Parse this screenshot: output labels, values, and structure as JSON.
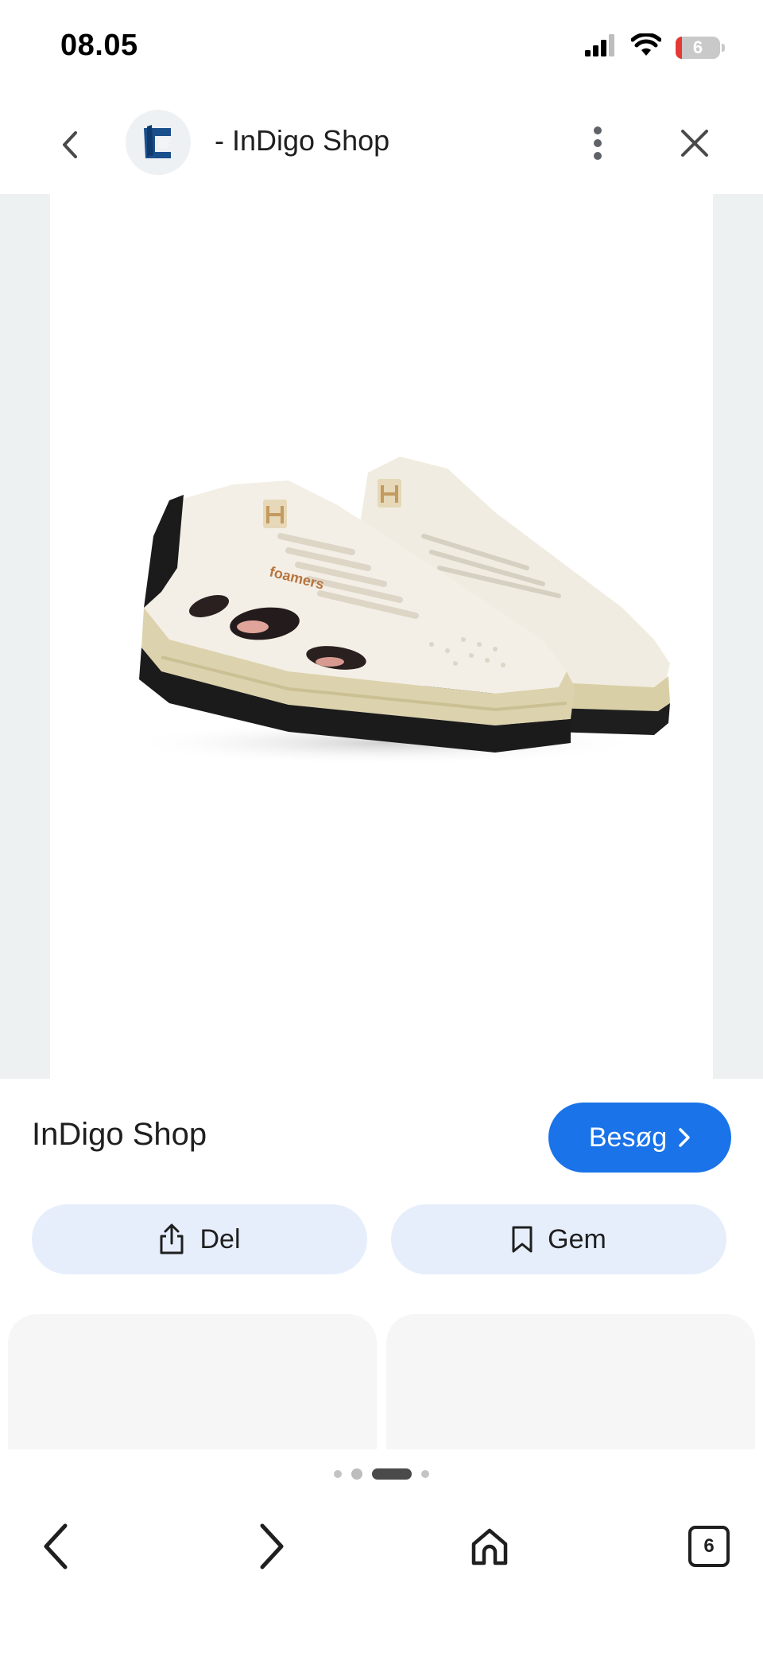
{
  "status_bar": {
    "time": "08.05",
    "battery_level": "6",
    "icons": [
      "signal-icon",
      "wifi-icon",
      "battery-icon"
    ]
  },
  "top_bar": {
    "title": "- InDigo Shop",
    "icons": [
      "back-icon",
      "site-logo",
      "more-vertical-icon",
      "close-icon"
    ]
  },
  "shop": {
    "name": "InDigo Shop",
    "visit_label": "Besøg"
  },
  "actions": {
    "share_label": "Del",
    "save_label": "Gem"
  },
  "pager": {
    "page_count": 4,
    "active_index": 2
  },
  "bottom_nav": {
    "tab_count": "6",
    "icons": [
      "back-icon",
      "forward-icon",
      "home-icon",
      "tabs-icon"
    ]
  },
  "colors": {
    "accent": "#1a73e8",
    "tonal_button": "#e6eefc",
    "image_background": "#edf1f2",
    "card_placeholder": "#f6f6f6"
  }
}
